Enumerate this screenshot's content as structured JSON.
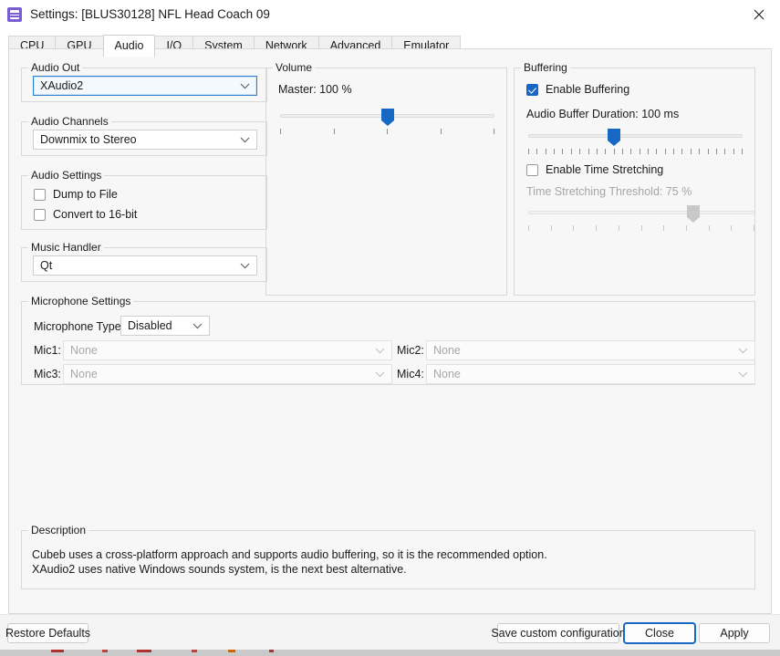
{
  "window": {
    "title": "Settings: [BLUS30128] NFL Head Coach 09",
    "app_icon": "settings-window-icon",
    "close_icon": "close-icon",
    "accent_color": "#1668c4",
    "focus_color": "#2f7fd1"
  },
  "tabs": [
    {
      "label": "CPU",
      "active": false
    },
    {
      "label": "GPU",
      "active": false
    },
    {
      "label": "Audio",
      "active": true
    },
    {
      "label": "I/O",
      "active": false
    },
    {
      "label": "System",
      "active": false
    },
    {
      "label": "Network",
      "active": false
    },
    {
      "label": "Advanced",
      "active": false
    },
    {
      "label": "Emulator",
      "active": false
    }
  ],
  "audio_out": {
    "group_label": "Audio Out",
    "value": "XAudio2",
    "focused": true
  },
  "audio_channels": {
    "group_label": "Audio Channels",
    "value": "Downmix to Stereo"
  },
  "audio_settings": {
    "group_label": "Audio Settings",
    "dump_to_file": {
      "label": "Dump to File",
      "checked": false
    },
    "convert_16bit": {
      "label": "Convert to 16-bit",
      "checked": false
    }
  },
  "music_handler": {
    "group_label": "Music Handler",
    "value": "Qt"
  },
  "volume": {
    "group_label": "Volume",
    "master_label": "Master: 100 %",
    "master_percent": 100,
    "slider_position_pct": 50,
    "tick_count": 5
  },
  "buffering": {
    "group_label": "Buffering",
    "enable_buffering": {
      "label": "Enable Buffering",
      "checked": true
    },
    "buffer_duration_label": "Audio Buffer Duration: 100 ms",
    "buffer_duration_ms": 100,
    "buffer_slider_position_pct": 40,
    "buffer_tick_count": 26,
    "enable_time_stretching": {
      "label": "Enable Time Stretching",
      "checked": false
    },
    "time_stretch_label": "Time Stretching Threshold: 75 %",
    "time_stretch_percent": 75,
    "time_stretch_slider_position_pct": 73,
    "time_stretch_tick_count": 11,
    "time_stretch_disabled": true
  },
  "microphone": {
    "group_label": "Microphone Settings",
    "type_label": "Microphone Type:",
    "type_value": "Disabled",
    "mic1_label": "Mic1:",
    "mic1_value": "None",
    "mic2_label": "Mic2:",
    "mic2_value": "None",
    "mic3_label": "Mic3:",
    "mic3_value": "None",
    "mic4_label": "Mic4:",
    "mic4_value": "None"
  },
  "description": {
    "group_label": "Description",
    "text": "Cubeb uses a cross-platform approach and supports audio buffering, so it is the recommended option.\nXAudio2 uses native Windows sounds system, is the next best alternative."
  },
  "footer": {
    "restore_defaults": "Restore Defaults",
    "save_custom_configuration": "Save custom configuration",
    "close": "Close",
    "apply": "Apply",
    "focused_button": "close"
  }
}
